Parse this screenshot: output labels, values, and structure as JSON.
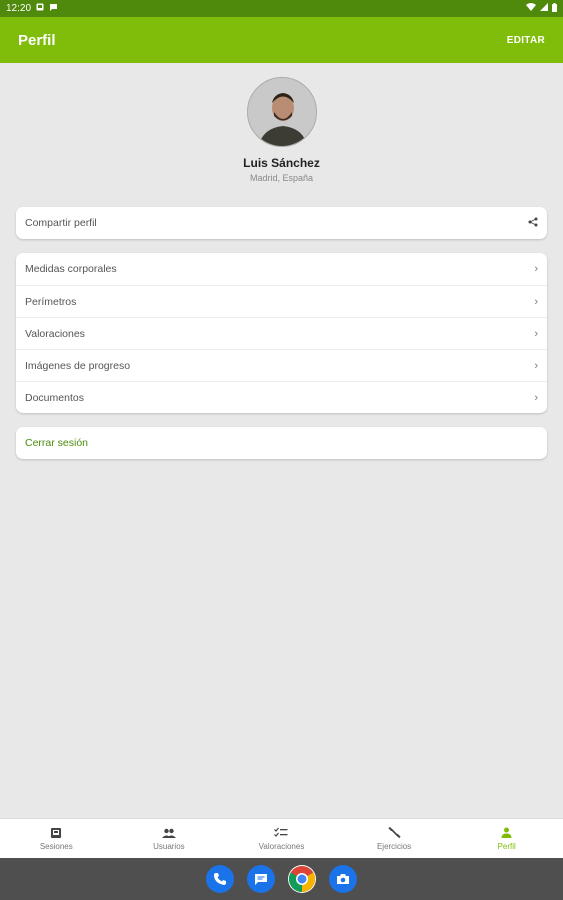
{
  "status_bar": {
    "time": "12:20"
  },
  "app_bar": {
    "title": "Perfil",
    "edit_label": "EDITAR"
  },
  "profile": {
    "name": "Luis Sánchez",
    "location": "Madrid, España"
  },
  "share": {
    "label": "Compartir perfil",
    "icon": "share-icon"
  },
  "menu": {
    "items": [
      {
        "label": "Medidas corporales"
      },
      {
        "label": "Perímetros"
      },
      {
        "label": "Valoraciones"
      },
      {
        "label": "Imágenes de progreso"
      },
      {
        "label": "Documentos"
      }
    ]
  },
  "logout": {
    "label": "Cerrar sesión"
  },
  "bottom_nav": {
    "items": [
      {
        "label": "Sesiones",
        "icon": "sessions-icon"
      },
      {
        "label": "Usuarios",
        "icon": "users-icon"
      },
      {
        "label": "Valoraciones",
        "icon": "checklist-icon"
      },
      {
        "label": "Ejercicios",
        "icon": "exercise-icon"
      },
      {
        "label": "Perfil",
        "icon": "person-icon",
        "active": true
      }
    ]
  },
  "dock": [
    {
      "name": "phone-app-icon"
    },
    {
      "name": "messages-app-icon"
    },
    {
      "name": "chrome-app-icon"
    },
    {
      "name": "camera-app-icon"
    }
  ],
  "colors": {
    "primary": "#7fbd0a",
    "status_bar": "#4f8a0c",
    "logout": "#4a8c0b",
    "background": "#e8e8e8"
  }
}
